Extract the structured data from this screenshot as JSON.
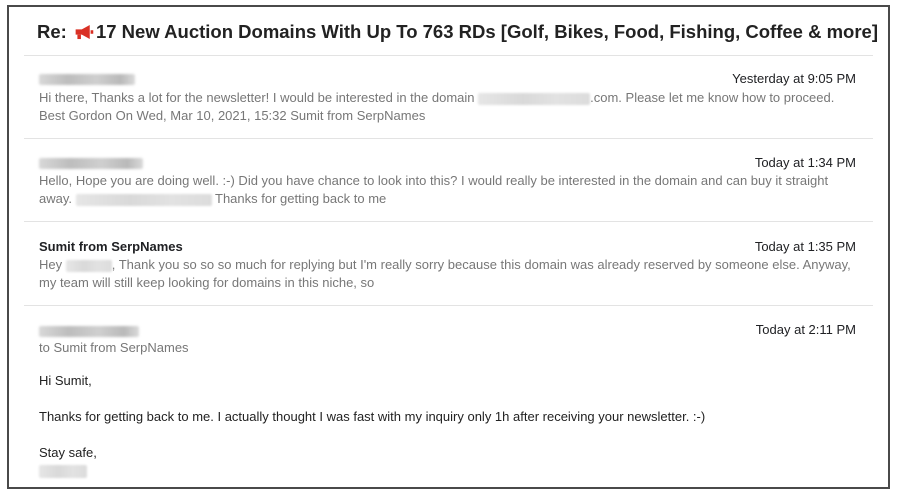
{
  "thread": {
    "subject_prefix": "Re:",
    "subject_text": "17 New Auction Domains With Up To 763 RDs [Golf, Bikes, Food, Fishing, Coffee & more]"
  },
  "messages": [
    {
      "sender": "",
      "time": "Yesterday at 9:05 PM",
      "snippet_part1": "Hi there, Thanks a lot for the newsletter! I would be interested in the domain",
      "snippet_part2": ".com. Please let me know how to proceed.",
      "snippet_line2": "Best Gordon On Wed, Mar 10, 2021, 15:32 Sumit from SerpNames"
    },
    {
      "sender": "",
      "time": "Today at 1:34 PM",
      "snippet_line1": "Hello, Hope you are doing well. :-) Did you have chance to look into this? I would really be interested in the domain and can buy it straight",
      "snippet_line2_start": "away.",
      "snippet_line2_end": "Thanks for getting back to me"
    },
    {
      "sender": "Sumit from SerpNames",
      "time": "Today at 1:35 PM",
      "snippet_line1_start": "Hey",
      "snippet_line1_end": ", Thank you so so so much for replying but I'm really sorry because this domain was already reserved by someone else. Anyway,",
      "snippet_line2": "my team will still keep looking for domains in this niche, so"
    },
    {
      "sender": "",
      "time": "Today at 2:11 PM",
      "to_line": "to Sumit from SerpNames",
      "greeting": "Hi Sumit,",
      "body": "Thanks for getting back to me. I actually thought I was fast with my inquiry only 1h after receiving your newsletter. :-)",
      "signoff": "Stay safe,"
    }
  ],
  "icons": {
    "subject_icon": "megaphone-icon"
  },
  "colors": {
    "megaphone": "#d93025",
    "snippet": "#777777",
    "text": "#222222"
  }
}
